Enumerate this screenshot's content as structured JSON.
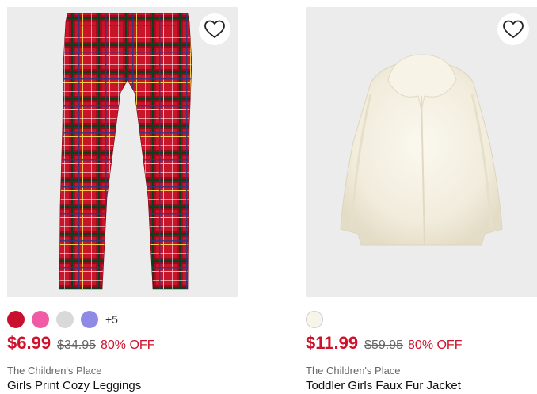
{
  "products": [
    {
      "name": "Girls Print Cozy Leggings",
      "brand": "The Children's Place",
      "price": "$6.99",
      "original_price": "$34.95",
      "discount": "80% OFF",
      "more_colors": "+5",
      "swatches": [
        "#c8102e",
        "#f15aa4",
        "#d9d9d9",
        "#8e8ae6"
      ],
      "image": "red-plaid-leggings"
    },
    {
      "name": "Toddler Girls Faux Fur Jacket",
      "brand": "The Children's Place",
      "price": "$11.99",
      "original_price": "$59.95",
      "discount": "80% OFF",
      "swatches": [
        "#f7f4ea"
      ],
      "image": "cream-faux-fur-jacket"
    }
  ],
  "colors": {
    "sale": "#d0112b",
    "image_bg": "#ececec"
  },
  "icons": {
    "favorite": "heart-outline-icon"
  }
}
